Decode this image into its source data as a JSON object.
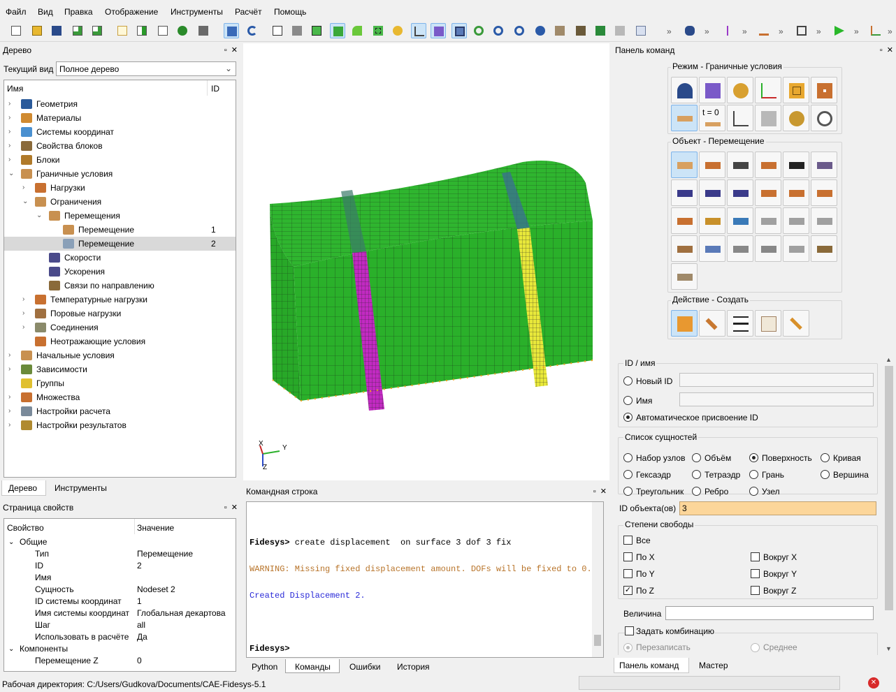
{
  "menu": [
    "Файл",
    "Вид",
    "Правка",
    "Отображение",
    "Инструменты",
    "Расчёт",
    "Помощь"
  ],
  "tree": {
    "title": "Дерево",
    "view_label": "Текущий вид",
    "view_value": "Полное дерево",
    "col_name": "Имя",
    "col_id": "ID",
    "items": [
      {
        "label": "Геометрия",
        "id": "",
        "depth": 0,
        "arrow": "›",
        "color": "#2a5a9a"
      },
      {
        "label": "Материалы",
        "id": "",
        "depth": 0,
        "arrow": "›",
        "color": "#d08a30"
      },
      {
        "label": "Системы координат",
        "id": "",
        "depth": 0,
        "arrow": "›",
        "color": "#4a90d0"
      },
      {
        "label": "Свойства блоков",
        "id": "",
        "depth": 0,
        "arrow": "›",
        "color": "#8a6a3a"
      },
      {
        "label": "Блоки",
        "id": "",
        "depth": 0,
        "arrow": "›",
        "color": "#b07a2a"
      },
      {
        "label": "Граничные условия",
        "id": "",
        "depth": 0,
        "arrow": "⌄",
        "color": "#c89050"
      },
      {
        "label": "Нагрузки",
        "id": "",
        "depth": 1,
        "arrow": "›",
        "color": "#c87030"
      },
      {
        "label": "Ограничения",
        "id": "",
        "depth": 1,
        "arrow": "⌄",
        "color": "#c89050"
      },
      {
        "label": "Перемещения",
        "id": "",
        "depth": 2,
        "arrow": "⌄",
        "color": "#c89050"
      },
      {
        "label": "Перемещение",
        "id": "1",
        "depth": 3,
        "arrow": "",
        "color": "#c89050"
      },
      {
        "label": "Перемещение",
        "id": "2",
        "depth": 3,
        "arrow": "",
        "color": "#8aa0b8"
      },
      {
        "label": "Скорости",
        "id": "",
        "depth": 2,
        "arrow": "",
        "color": "#4a4a8a"
      },
      {
        "label": "Ускорения",
        "id": "",
        "depth": 2,
        "arrow": "",
        "color": "#4a4a8a"
      },
      {
        "label": "Связи по направлению",
        "id": "",
        "depth": 2,
        "arrow": "",
        "color": "#8a6a3a"
      },
      {
        "label": "Температурные нагрузки",
        "id": "",
        "depth": 1,
        "arrow": "›",
        "color": "#c87030"
      },
      {
        "label": "Поровые нагрузки",
        "id": "",
        "depth": 1,
        "arrow": "›",
        "color": "#a07040"
      },
      {
        "label": "Соединения",
        "id": "",
        "depth": 1,
        "arrow": "›",
        "color": "#8a8a6a"
      },
      {
        "label": "Неотражающие условия",
        "id": "",
        "depth": 1,
        "arrow": "",
        "color": "#c87030"
      },
      {
        "label": "Начальные условия",
        "id": "",
        "depth": 0,
        "arrow": "›",
        "color": "#c89050"
      },
      {
        "label": "Зависимости",
        "id": "",
        "depth": 0,
        "arrow": "›",
        "color": "#6a8a3a"
      },
      {
        "label": "Группы",
        "id": "",
        "depth": 0,
        "arrow": "",
        "color": "#e0c030"
      },
      {
        "label": "Множества",
        "id": "",
        "depth": 0,
        "arrow": "›",
        "color": "#c87030"
      },
      {
        "label": "Настройки расчета",
        "id": "",
        "depth": 0,
        "arrow": "›",
        "color": "#7a8a9a"
      },
      {
        "label": "Настройки результатов",
        "id": "",
        "depth": 0,
        "arrow": "›",
        "color": "#b08a30"
      }
    ],
    "tabs": [
      "Дерево",
      "Инструменты"
    ]
  },
  "props": {
    "title": "Страница свойств",
    "col_prop": "Свойство",
    "col_val": "Значение",
    "rows": [
      {
        "k": "Общие",
        "v": "",
        "group": true
      },
      {
        "k": "Тип",
        "v": "Перемещение",
        "group": false
      },
      {
        "k": "ID",
        "v": "2",
        "group": false
      },
      {
        "k": "Имя",
        "v": "",
        "group": false
      },
      {
        "k": "Сущность",
        "v": "Nodeset 2",
        "group": false
      },
      {
        "k": "ID системы координат",
        "v": "1",
        "group": false
      },
      {
        "k": "Имя системы координат",
        "v": "Глобальная декартова",
        "group": false
      },
      {
        "k": "Шаг",
        "v": "all",
        "group": false
      },
      {
        "k": "Использовать в расчёте",
        "v": "Да",
        "group": false
      },
      {
        "k": "Компоненты",
        "v": "",
        "group": true
      },
      {
        "k": "Перемещение Z",
        "v": "0",
        "group": false
      }
    ]
  },
  "axes": {
    "x": "X",
    "y": "Y",
    "z": "Z"
  },
  "cmd": {
    "title": "Командная строка",
    "prompt1": "Fidesys>",
    "cmd1": " create displacement  on surface 3 dof 3 fix",
    "warning": "WARNING: Missing fixed displacement amount. DOFs will be fixed to 0.0",
    "created": "Created Displacement 2.",
    "prompt2": "Fidesys>",
    "tabs": [
      "Python",
      "Команды",
      "Ошибки",
      "История"
    ]
  },
  "cp": {
    "title": "Панель команд",
    "mode_label": "Режим - Граничные условия",
    "object_label": "Объект - Перемещение",
    "action_label": "Действие - Создать",
    "t0": "t = 0",
    "id_group": "ID / имя",
    "new_id": "Новый ID",
    "name": "Имя",
    "auto_id": "Автоматическое присвоение ID",
    "entity_group": "Список сущностей",
    "entities": [
      "Набор узлов",
      "Объём",
      "Поверхность",
      "Кривая",
      "Гексаэдр",
      "Тетраэдр",
      "Грань",
      "Вершина",
      "Треугольник",
      "Ребро",
      "Узел"
    ],
    "obj_id_label": "ID объекта(ов)",
    "obj_id_value": "3",
    "dof_group": "Степени свободы",
    "dof_all": "Все",
    "dofs": [
      "По X",
      "Вокруг X",
      "По Y",
      "Вокруг Y",
      "По Z",
      "Вокруг Z"
    ],
    "magnitude": "Величина",
    "combo": "Задать комбинацию",
    "overwrite": "Перезаписать",
    "average": "Среднее",
    "tabs": [
      "Панель команд",
      "Мастер"
    ]
  },
  "status": {
    "workdir": "Рабочая директория: C:/Users/Gudkova/Documents/CAE-Fidesys-5.1"
  }
}
